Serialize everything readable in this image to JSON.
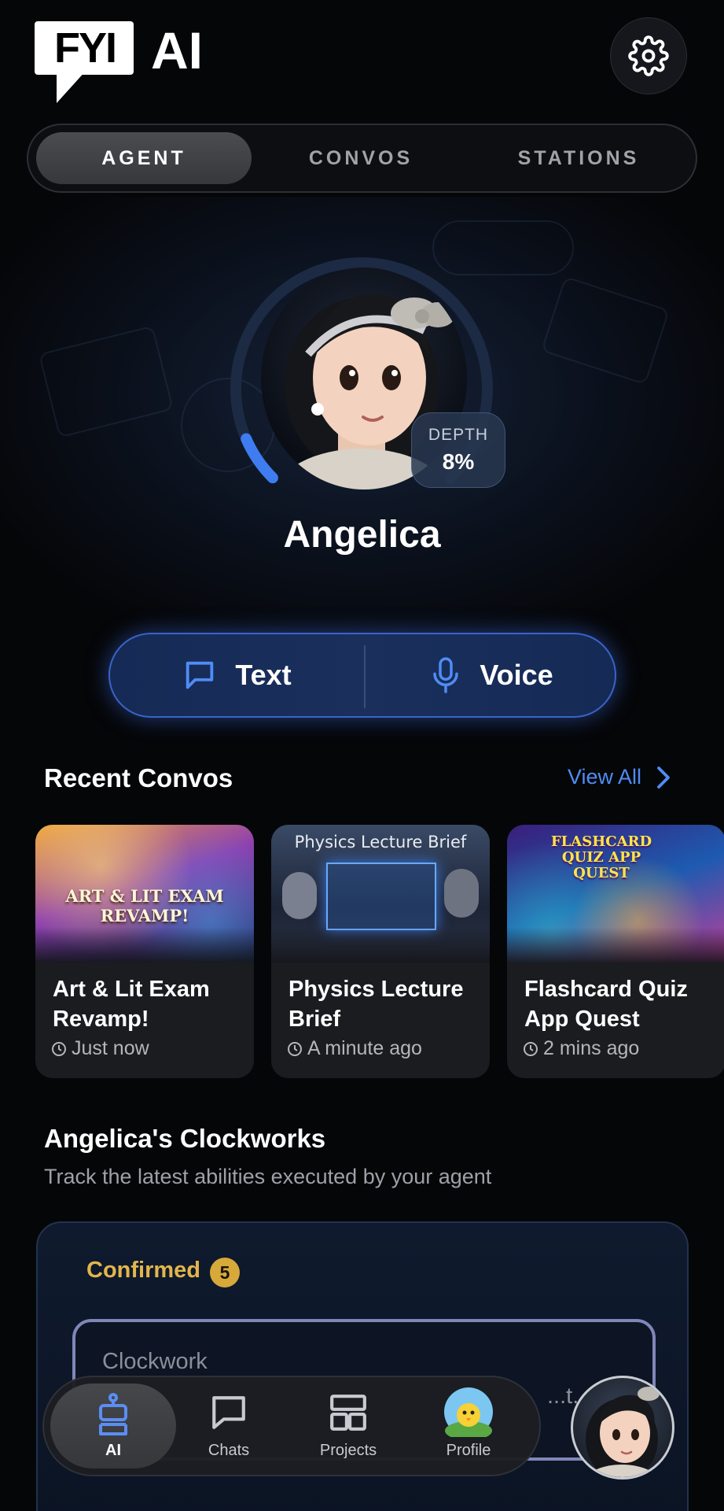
{
  "app": {
    "logo_text": "FYI",
    "logo_suffix": "AI",
    "settings_icon": "gear-icon"
  },
  "tabs": [
    {
      "label": "AGENT",
      "active": true
    },
    {
      "label": "CONVOS",
      "active": false
    },
    {
      "label": "STATIONS",
      "active": false
    }
  ],
  "agent": {
    "name": "Angelica",
    "depth_label": "DEPTH",
    "depth_value": "8%",
    "depth_fraction": 0.08
  },
  "modes": {
    "text_label": "Text",
    "text_icon": "chat-bubble-icon",
    "voice_label": "Voice",
    "voice_icon": "microphone-icon"
  },
  "recent": {
    "title": "Recent Convos",
    "view_all": "View All",
    "items": [
      {
        "thumb_title": "ART & LIT EXAM REVAMP!",
        "title": "Art & Lit Exam Revamp!",
        "time": "Just now"
      },
      {
        "thumb_title": "Physics Lecture Brief",
        "title": "Physics Lecture Brief",
        "time": "A minute ago"
      },
      {
        "thumb_title": "FLASHCARD QUIZ APP QUEST",
        "title": "Flashcard Quiz App Quest",
        "time": "2 mins ago"
      }
    ]
  },
  "clockworks": {
    "title": "Angelica's Clockworks",
    "subtitle": "Track the latest abilities executed by your agent",
    "confirmed_label": "Confirmed",
    "confirmed_count": "5",
    "card_label": "Clockwork",
    "card_more": "...t..."
  },
  "nav": [
    {
      "label": "AI",
      "icon": "robot-icon",
      "active": true
    },
    {
      "label": "Chats",
      "icon": "chat-bubble-icon",
      "active": false
    },
    {
      "label": "Projects",
      "icon": "projects-grid-icon",
      "active": false
    },
    {
      "label": "Profile",
      "icon": "profile-avatar-icon",
      "active": false
    }
  ],
  "colors": {
    "accent_blue": "#4f8cf5",
    "confirmed_gold": "#e2b64b",
    "background": "#050608"
  }
}
